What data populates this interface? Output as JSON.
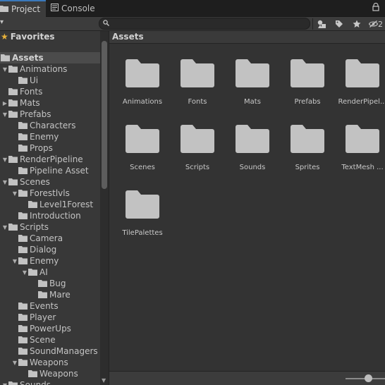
{
  "tabs": [
    {
      "label": "Project",
      "icon": "folder-icon"
    },
    {
      "label": "Console",
      "icon": "console-icon"
    }
  ],
  "toolbar": {
    "search_value": "",
    "hidden_count": "2"
  },
  "tree": [
    {
      "label": "Favorites",
      "type": "favorites",
      "depth": 0
    },
    {
      "label": "Assets",
      "type": "assets",
      "depth": 0,
      "selected": true
    },
    {
      "label": "Animations",
      "depth": 1,
      "expanded": true
    },
    {
      "label": "Ui",
      "depth": 2
    },
    {
      "label": "Fonts",
      "depth": 1
    },
    {
      "label": "Mats",
      "depth": 1,
      "collapsed": true
    },
    {
      "label": "Prefabs",
      "depth": 1,
      "expanded": true
    },
    {
      "label": "Characters",
      "depth": 2
    },
    {
      "label": "Enemy",
      "depth": 2
    },
    {
      "label": "Props",
      "depth": 2
    },
    {
      "label": "RenderPipeline",
      "depth": 1,
      "expanded": true
    },
    {
      "label": "Pipeline Asset",
      "depth": 2
    },
    {
      "label": "Scenes",
      "depth": 1,
      "expanded": true
    },
    {
      "label": "Forestlvls",
      "depth": 2,
      "expanded": true
    },
    {
      "label": "Level1Forest",
      "depth": 3
    },
    {
      "label": "Introduction",
      "depth": 2
    },
    {
      "label": "Scripts",
      "depth": 1,
      "expanded": true
    },
    {
      "label": "Camera",
      "depth": 2
    },
    {
      "label": "Dialog",
      "depth": 2
    },
    {
      "label": "Enemy",
      "depth": 2,
      "expanded": true
    },
    {
      "label": "AI",
      "depth": 3,
      "expanded": true
    },
    {
      "label": "Bug",
      "depth": 4
    },
    {
      "label": "Mare",
      "depth": 4
    },
    {
      "label": "Events",
      "depth": 2
    },
    {
      "label": "Player",
      "depth": 2
    },
    {
      "label": "PowerUps",
      "depth": 2
    },
    {
      "label": "Scene",
      "depth": 2
    },
    {
      "label": "SoundManagers",
      "depth": 2
    },
    {
      "label": "Weapons",
      "depth": 2,
      "expanded": true
    },
    {
      "label": "Weapons",
      "depth": 3
    },
    {
      "label": "Sounds",
      "depth": 1,
      "expanded": true
    }
  ],
  "main": {
    "breadcrumb": "Assets",
    "items": [
      {
        "label": "Animations"
      },
      {
        "label": "Fonts"
      },
      {
        "label": "Mats"
      },
      {
        "label": "Prefabs"
      },
      {
        "label": "RenderPipel..."
      },
      {
        "label": "Scenes"
      },
      {
        "label": "Scripts"
      },
      {
        "label": "Sounds"
      },
      {
        "label": "Sprites"
      },
      {
        "label": "TextMesh ..."
      },
      {
        "label": "TilePalettes"
      }
    ]
  },
  "colors": {
    "folder": "#c2c2c2",
    "accent": "#3a79bb",
    "star": "#e8b23a"
  }
}
